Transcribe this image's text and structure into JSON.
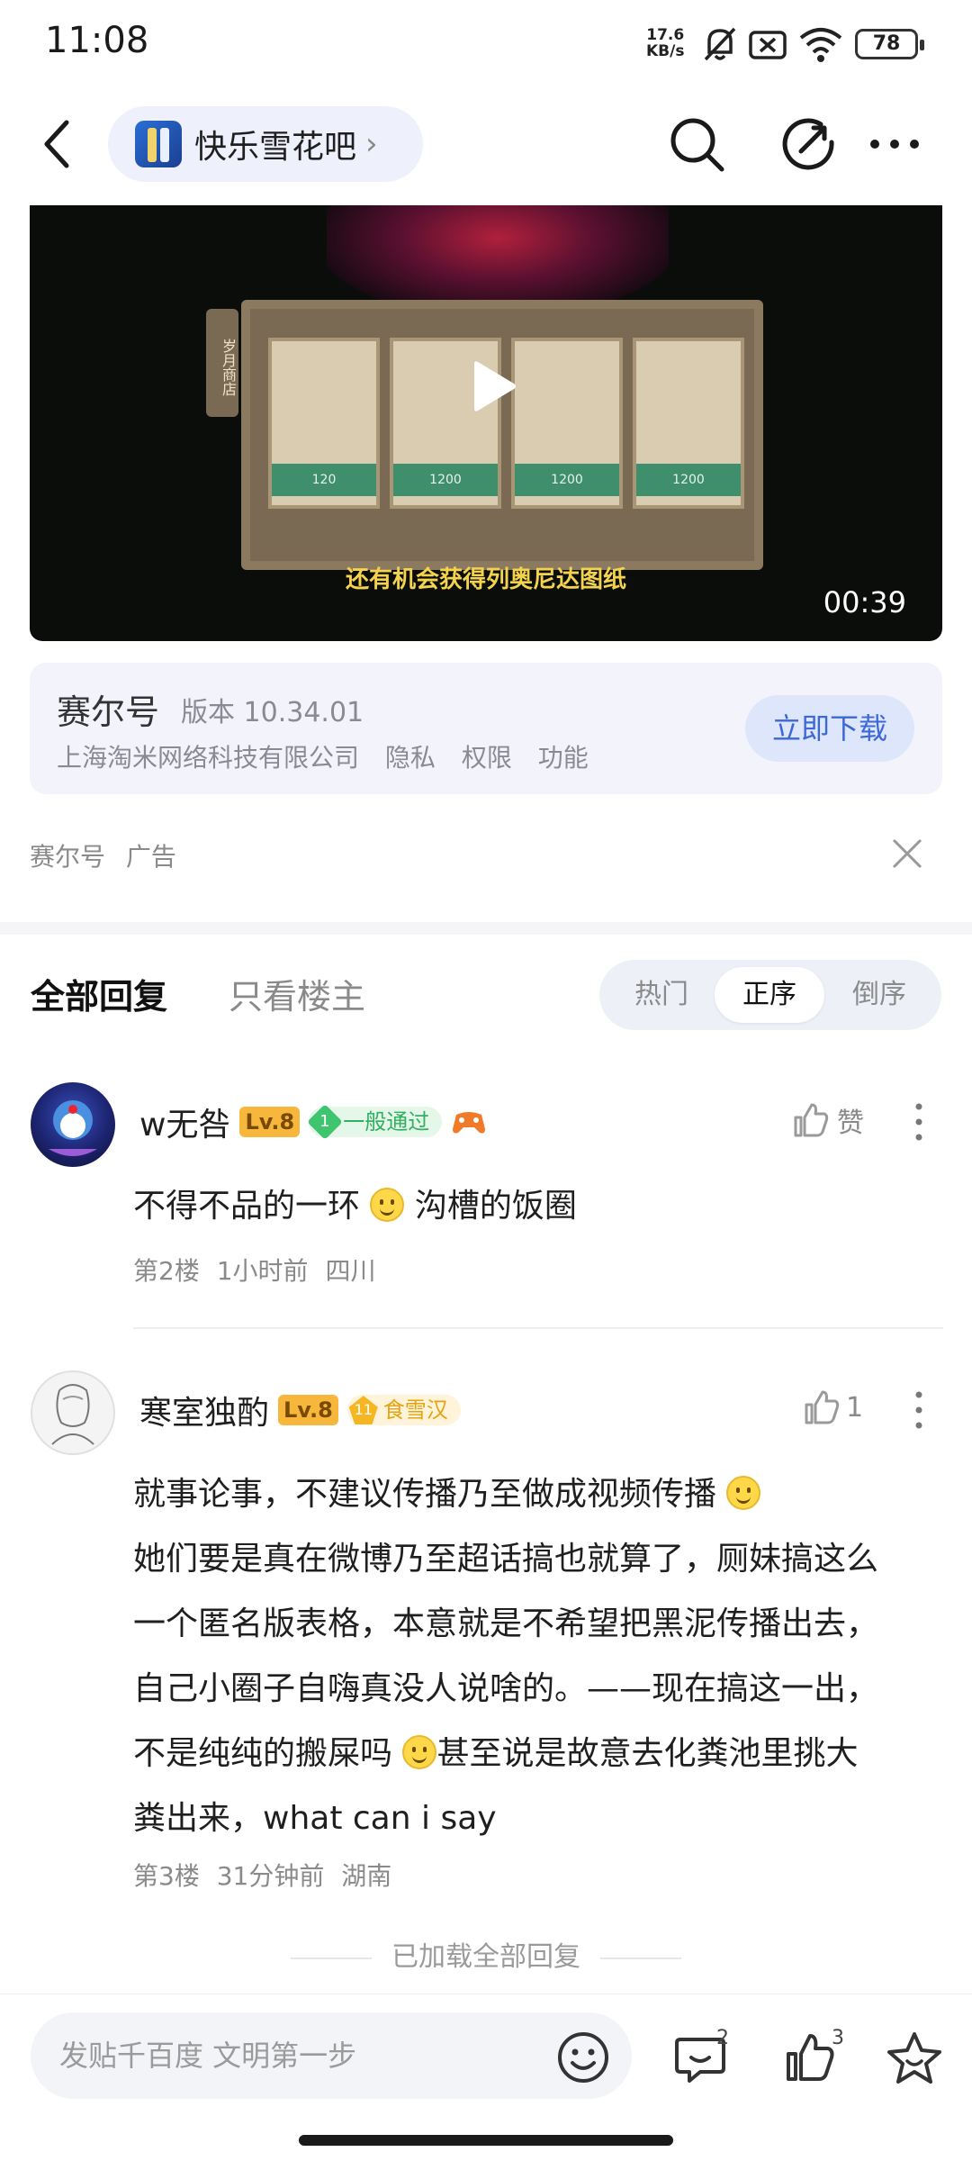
{
  "status_bar": {
    "time": "11:08",
    "net_speed_top": "17.6",
    "net_speed_bottom": "KB/s",
    "battery": "78"
  },
  "nav": {
    "forum_name": "快乐雪花吧",
    "chevron": "›"
  },
  "video": {
    "caption": "还有机会获得列奥尼达图纸",
    "duration": "00:39",
    "side_label": "岁月商店",
    "shop_prices": [
      "120",
      "1200",
      "1200",
      "1200"
    ]
  },
  "ad": {
    "app_name": "赛尔号",
    "version": "版本 10.34.01",
    "developer": "上海淘米网络科技有限公司",
    "links": [
      "隐私",
      "权限",
      "功能"
    ],
    "download": "立即下载",
    "footer_source": "赛尔号",
    "footer_tag": "广告"
  },
  "tabs": {
    "all_replies": "全部回复",
    "op_only": "只看楼主",
    "sort_hot": "热门",
    "sort_asc": "正序",
    "sort_desc": "倒序"
  },
  "comments": [
    {
      "username": "w无咎",
      "level": "Lv.8",
      "badge_num": "1",
      "badge_text": "一般通过",
      "like_label": "赞",
      "text_before": "不得不品的一环 ",
      "text_after": "沟槽的饭圈",
      "floor": "第2楼",
      "time": "1小时前",
      "location": "四川"
    },
    {
      "username": "寒室独酌",
      "level": "Lv.8",
      "badge_num": "11",
      "badge_text": "食雪汉",
      "like_count": "1",
      "line1": "就事论事，不建议传播乃至做成视频传播 ",
      "line2": "她们要是真在微博乃至超话搞也就算了，厕妹搞这么",
      "line3": "一个匿名版表格，本意就是不希望把黑泥传播出去，",
      "line4": "自己小圈子自嗨真没人说啥的。——现在搞这一出，",
      "line5a": "不是纯纯的搬屎吗 ",
      "line5b": "甚至说是故意去化粪池里挑大",
      "line6": "粪出来，what can i say",
      "floor": "第3楼",
      "time": "31分钟前",
      "location": "湖南"
    }
  ],
  "loaded_text": "已加载全部回复",
  "bottom_bar": {
    "placeholder": "发贴千百度 文明第一步",
    "comment_count": "2",
    "like_count": "3"
  }
}
